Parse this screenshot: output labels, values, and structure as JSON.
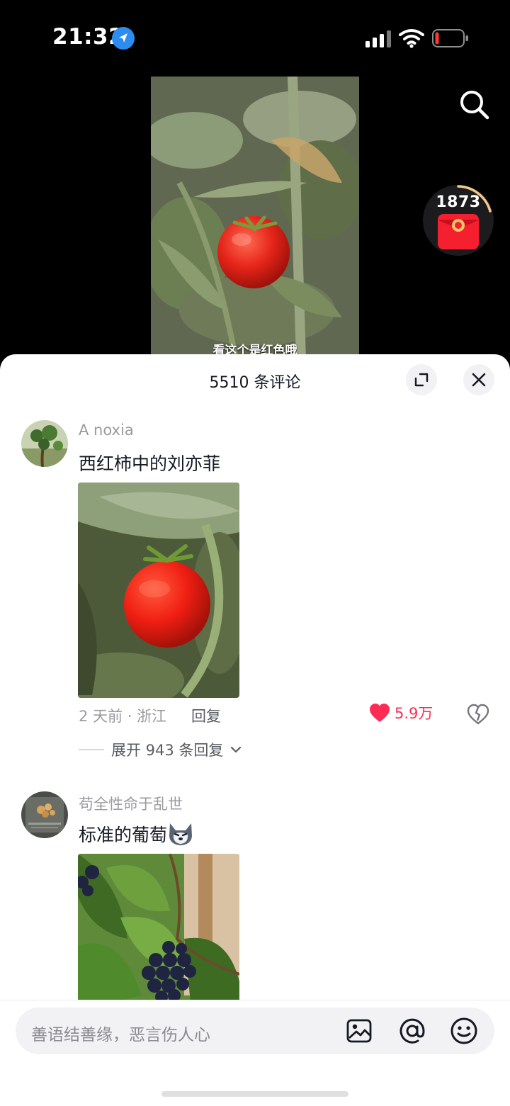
{
  "status_bar": {
    "time": "21:32",
    "icons": [
      "location-arrow-icon",
      "cellular-signal-icon",
      "wifi-icon",
      "battery-low-icon"
    ]
  },
  "video": {
    "subtitle": "看这个是红色哦",
    "reward_count": "1873",
    "icons": [
      "search-icon",
      "red-envelope-icon"
    ]
  },
  "comments_panel": {
    "title": "5510 条评论",
    "icons": [
      "expand-icon",
      "close-icon"
    ],
    "comments": [
      {
        "username": "A noxia",
        "text": "西红柿中的刘亦菲",
        "meta": "2 天前 · 浙江",
        "reply_label": "回复",
        "likes": "5.9万",
        "expand_replies": "展开 943 条回复"
      },
      {
        "username": "苟全性命于乱世",
        "text": "标准的葡萄",
        "emoji": "husky-emoji-icon"
      }
    ]
  },
  "input_bar": {
    "placeholder": "善语结善缘，恶言伤人心",
    "icons": [
      "image-icon",
      "mention-icon",
      "emoji-icon"
    ]
  },
  "colors": {
    "like_red": "#fe2c55",
    "muted_text": "#9a9ba1",
    "panel_bg": "#ffffff",
    "input_bg": "#f2f2f4"
  }
}
